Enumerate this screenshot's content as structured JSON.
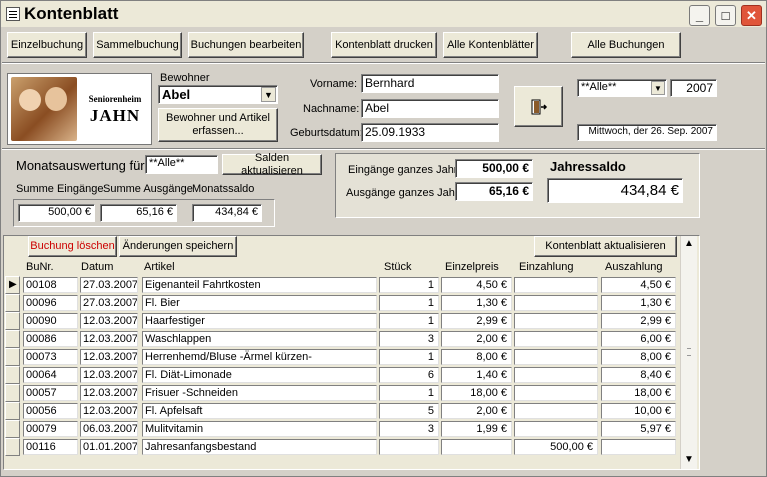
{
  "window": {
    "title": "Kontenblatt",
    "minimize": "_",
    "maximize": "□",
    "close": "✕"
  },
  "toolbar": {
    "einzelbuchung": "Einzelbuchung",
    "sammelbuchung": "Sammelbuchung",
    "buchungen_bearbeiten": "Buchungen bearbeiten",
    "kontenblatt_drucken": "Kontenblatt drucken",
    "alle_kontenblaetter": "Alle Kontenblätter",
    "alle_buchungen": "Alle Buchungen"
  },
  "logo": {
    "line1": "Seniorenheim",
    "line2": "JAHN"
  },
  "bewohner": {
    "label": "Bewohner",
    "value": "Abel",
    "button": "Bewohner und Artikel erfassen..."
  },
  "person": {
    "vorname_label": "Vorname:",
    "vorname": "Bernhard",
    "nachname_label": "Nachname:",
    "nachname": "Abel",
    "geburtsdatum_label": "Geburtsdatum:",
    "geburtsdatum": "25.09.1933"
  },
  "filter": {
    "monat": "**Alle**",
    "jahr": "2007",
    "datum": "Mittwoch, der 26. Sep. 2007"
  },
  "monat": {
    "label": "Monatsauswertung für",
    "value": "**Alle**",
    "salden_button": "Salden aktualisieren",
    "summe_eingaenge_label": "Summe Eingänge",
    "summe_eingaenge": "500,00 €",
    "summe_ausgaenge_label": "Summe Ausgänge",
    "summe_ausgaenge": "65,16 €",
    "monatssaldo_label": "Monatssaldo",
    "monatssaldo": "434,84 €"
  },
  "jahr": {
    "eingaenge_label": "Eingänge ganzes Jahr",
    "eingaenge": "500,00 €",
    "ausgaenge_label": "Ausgänge ganzes Jahr",
    "ausgaenge": "65,16 €",
    "saldo_label": "Jahressaldo",
    "saldo": "434,84 €"
  },
  "grid_actions": {
    "loeschen": "Buchung löschen",
    "speichern": "Änderungen speichern",
    "aktualisieren": "Kontenblatt aktualisieren"
  },
  "columns": [
    "BuNr.",
    "Datum",
    "Artikel",
    "Stück",
    "Einzelpreis",
    "Einzahlung",
    "Auszahlung"
  ],
  "rows": [
    [
      "00108",
      "27.03.2007",
      "Eigenanteil Fahrtkosten",
      "1",
      "4,50 €",
      "",
      "4,50 €"
    ],
    [
      "00096",
      "27.03.2007",
      "Fl. Bier",
      "1",
      "1,30 €",
      "",
      "1,30 €"
    ],
    [
      "00090",
      "12.03.2007",
      "Haarfestiger",
      "1",
      "2,99 €",
      "",
      "2,99 €"
    ],
    [
      "00086",
      "12.03.2007",
      "Waschlappen",
      "3",
      "2,00 €",
      "",
      "6,00 €"
    ],
    [
      "00073",
      "12.03.2007",
      "Herrenhemd/Bluse -Ärmel kürzen-",
      "1",
      "8,00 €",
      "",
      "8,00 €"
    ],
    [
      "00064",
      "12.03.2007",
      "Fl. Diät-Limonade",
      "6",
      "1,40 €",
      "",
      "8,40 €"
    ],
    [
      "00057",
      "12.03.2007",
      "Frisuer -Schneiden",
      "1",
      "18,00 €",
      "",
      "18,00 €"
    ],
    [
      "00056",
      "12.03.2007",
      "Fl. Apfelsaft",
      "5",
      "2,00 €",
      "",
      "10,00 €"
    ],
    [
      "00079",
      "06.03.2007",
      "Mulitvitamin",
      "3",
      "1,99 €",
      "",
      "5,97 €"
    ],
    [
      "00116",
      "01.01.2007",
      "Jahresanfangsbestand",
      "",
      "",
      "500,00 €",
      ""
    ]
  ]
}
